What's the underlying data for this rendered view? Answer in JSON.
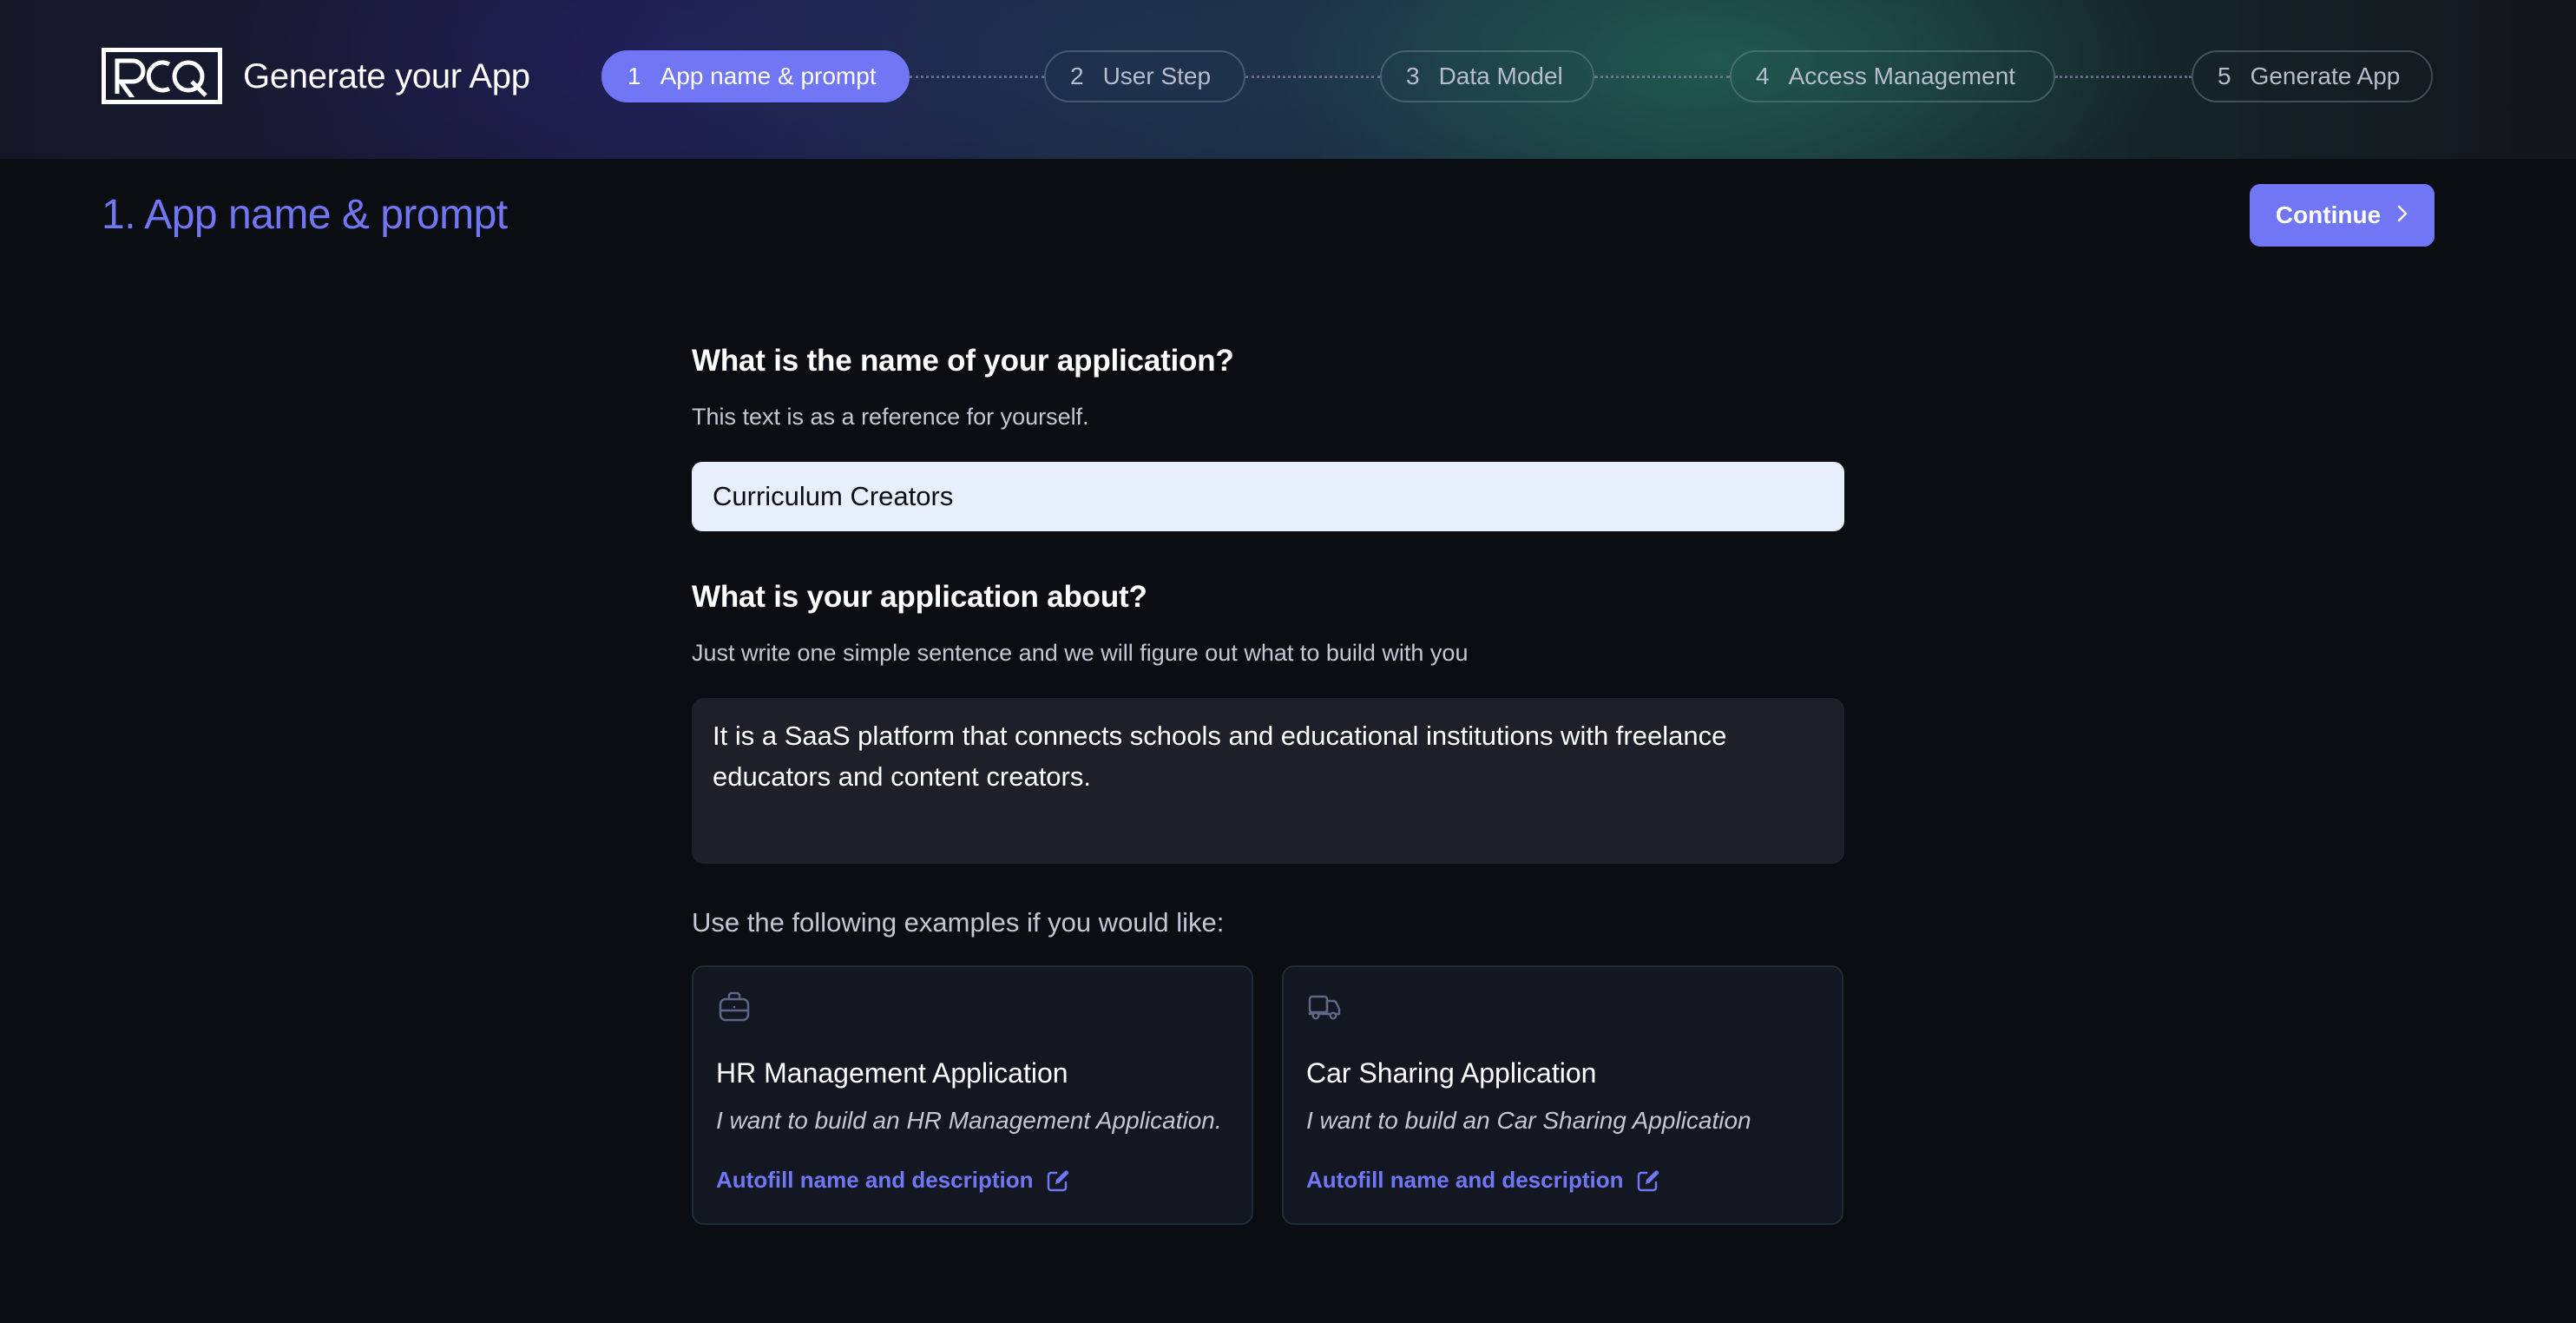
{
  "header": {
    "logo_text": "RCQ",
    "app_title": "Generate your App",
    "steps": [
      {
        "number": "1",
        "label": "App name & prompt",
        "state": "active"
      },
      {
        "number": "2",
        "label": "User Step",
        "state": "inactive"
      },
      {
        "number": "3",
        "label": "Data Model",
        "state": "inactive"
      },
      {
        "number": "4",
        "label": "Access Management",
        "state": "inactive"
      },
      {
        "number": "5",
        "label": "Generate App",
        "state": "inactive"
      }
    ]
  },
  "page": {
    "title": "1. App name & prompt",
    "continue_label": "Continue",
    "continue_icon": "chevron-right-icon"
  },
  "form": {
    "name_question": "What is the name of your application?",
    "name_help": "This text is as a reference for yourself.",
    "name_value": "Curriculum Creators",
    "about_question": "What is your application about?",
    "about_help": "Just write one simple sentence and we will figure out what to build with you",
    "about_value": "It is a SaaS platform that connects schools and educational institutions with freelance educators and content creators.",
    "examples_label": "Use the following examples if you would like:",
    "examples": [
      {
        "icon": "briefcase-icon",
        "title": "HR Management Application",
        "description": "I want to build an HR Management Application.",
        "action_label": "Autofill name and description",
        "action_icon": "edit-icon"
      },
      {
        "icon": "truck-icon",
        "title": "Car Sharing Application",
        "description": "I want to build an Car Sharing Application",
        "action_label": "Autofill name and description",
        "action_icon": "edit-icon"
      }
    ]
  },
  "colors": {
    "accent": "#7177f4",
    "background": "#0a0e13",
    "card_background": "#131722",
    "input_background": "#e8effc",
    "textarea_background": "#1d2029"
  }
}
